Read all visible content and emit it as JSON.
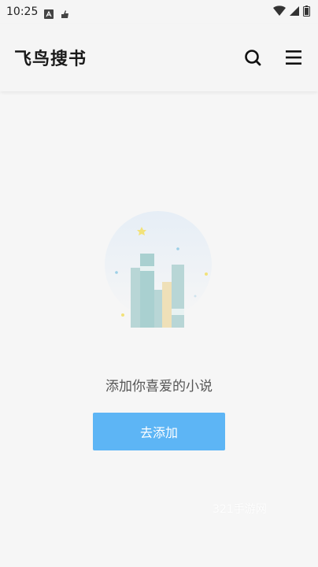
{
  "status_bar": {
    "time": "10:25",
    "icons": [
      "notification-a-icon",
      "notification-app-icon",
      "wifi-icon",
      "signal-icon",
      "battery-icon"
    ]
  },
  "app_bar": {
    "title": "飞鸟搜书",
    "actions": [
      "search-icon",
      "menu-icon"
    ]
  },
  "empty_state": {
    "illustration": "books-empty-icon",
    "message": "添加你喜爱的小说",
    "button_label": "去添加"
  },
  "watermark": {
    "text": "321手游网"
  },
  "colors": {
    "accent": "#5db5f5",
    "background": "#f6f6f6"
  }
}
